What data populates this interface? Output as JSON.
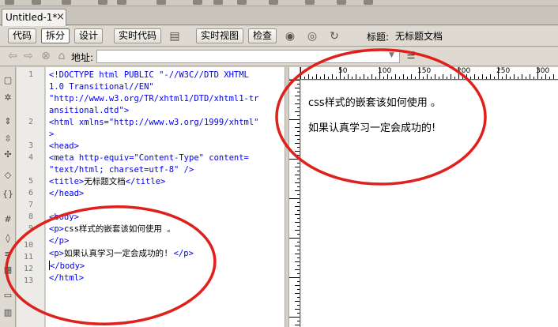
{
  "document_tab": {
    "title": "Untitled-1*",
    "close": "×"
  },
  "toolbar": {
    "view_buttons": [
      "代码",
      "拆分",
      "设计"
    ],
    "active_view": "拆分",
    "live_code": "实时代码",
    "live_view": "实时视图",
    "inspect": "检查",
    "title_label": "标题:",
    "title_value": "无标题文档"
  },
  "address_bar": {
    "label": "地址:",
    "value": ""
  },
  "code_view": {
    "line_numbers": [
      "1",
      "2",
      "3",
      "4",
      "5",
      "6",
      "7",
      "8",
      "9",
      "10",
      "11",
      "12",
      "13"
    ],
    "lines": [
      "<!DOCTYPE html PUBLIC \"-//W3C//DTD XHTML",
      "1.0 Transitional//EN\"",
      "\"http://www.w3.org/TR/xhtml1/DTD/xhtml1-tr",
      "ansitional.dtd\">",
      "<html xmlns=\"http://www.w3.org/1999/xhtml\"",
      ">",
      "<head>",
      "<meta http-equiv=\"Content-Type\" content=",
      "\"text/html; charset=utf-8\" />",
      "<title>",
      "无标题文档",
      "</title>",
      "</head>",
      "<body>",
      "<p>",
      "css样式的嵌套该如何使用 。",
      "</p>",
      "<p>",
      "如果认真学习一定会成功的!",
      "</p>",
      "</body>",
      "</html>"
    ]
  },
  "ruler": {
    "labels": [
      "50",
      "100",
      "150",
      "200",
      "250",
      "300"
    ]
  },
  "design_view": {
    "paragraphs": [
      "css样式的嵌套该如何使用 。",
      "如果认真学习一定会成功的!"
    ]
  },
  "colors": {
    "tag": "#0000ee",
    "annotation": "#e0201c",
    "background": "#d4d0c8"
  }
}
